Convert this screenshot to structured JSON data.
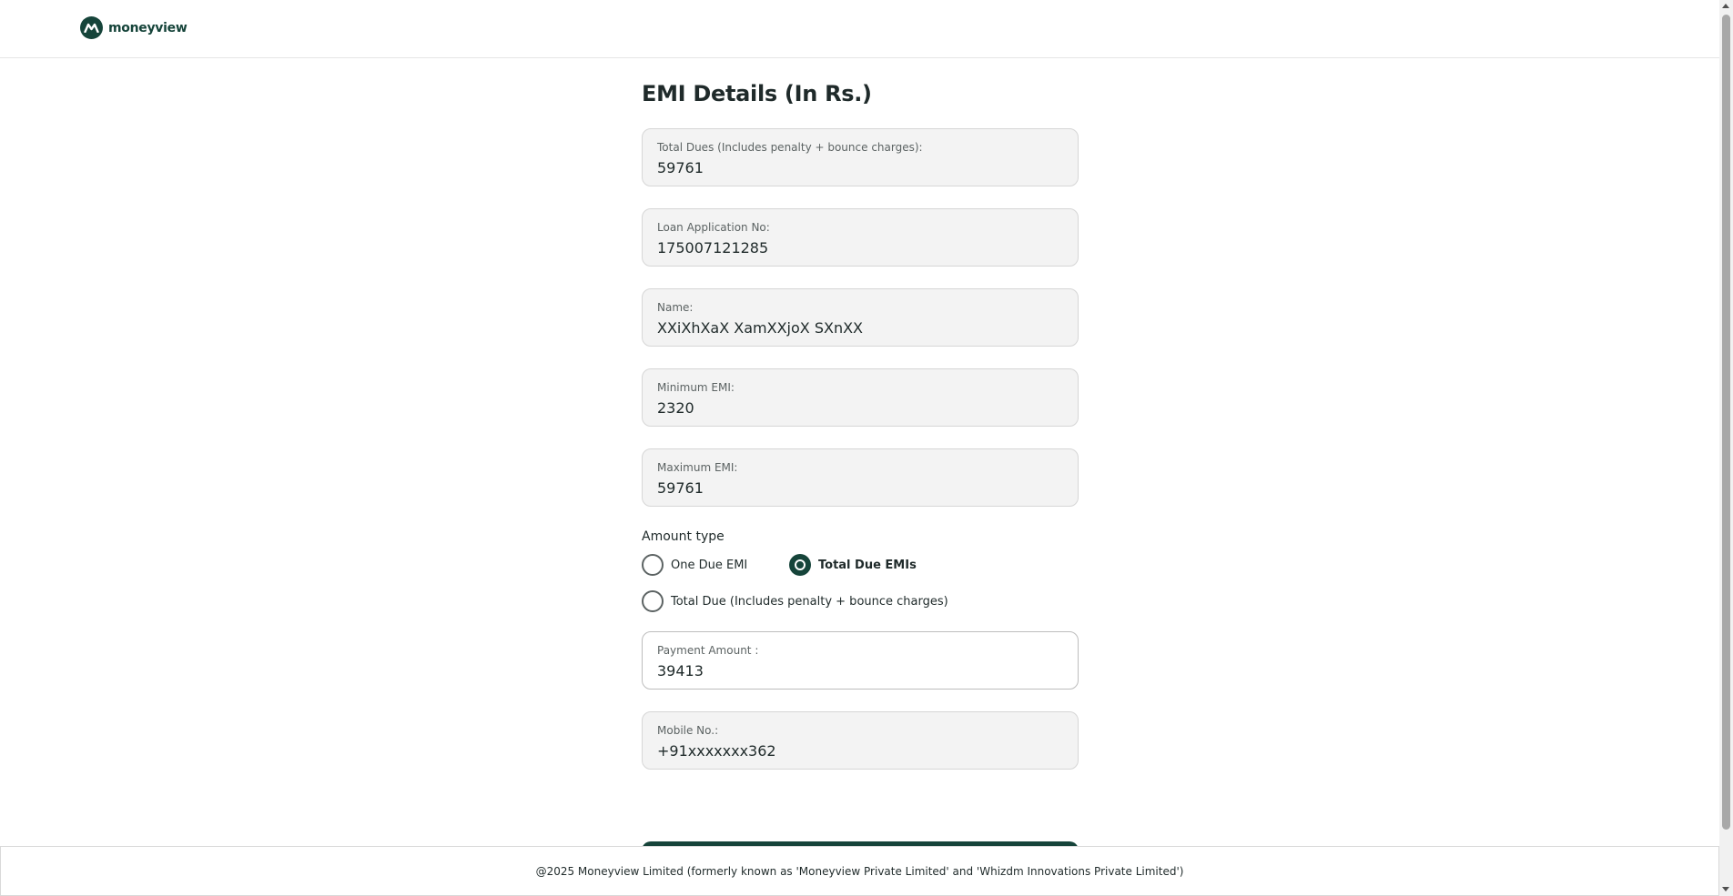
{
  "header": {
    "logo_text": "moneyview",
    "logo_icon": "moneyview-logo-icon"
  },
  "page_title": "EMI Details (In Rs.)",
  "details": [
    {
      "label": "Total Dues (Includes penalty + bounce charges):",
      "value": "59761"
    },
    {
      "label": "Loan Application No:",
      "value": "175007121285"
    },
    {
      "label": "Name:",
      "value": "XXiXhXaX XamXXjoX SXnXX"
    },
    {
      "label": "Minimum EMI:",
      "value": "2320"
    },
    {
      "label": "Maximum EMI:",
      "value": "59761"
    }
  ],
  "amount_type": {
    "label": "Amount type",
    "options": [
      {
        "label": "One Due EMI",
        "selected": false
      },
      {
        "label": "Total Due EMIs",
        "selected": true
      },
      {
        "label": "Total Due (Includes penalty + bounce charges)",
        "selected": false
      }
    ]
  },
  "payment_amount": {
    "label": "Payment Amount :",
    "value": "39413"
  },
  "mobile": {
    "label": "Mobile No.:",
    "value": "+91xxxxxxx362"
  },
  "footer": {
    "text": "@2025 Moneyview Limited (formerly known as 'Moneyview Private Limited' and 'Whizdm Innovations Private Limited')"
  },
  "colors": {
    "brand": "#16443a",
    "field_bg": "#f3f3f3",
    "text": "#1f2a2a"
  }
}
